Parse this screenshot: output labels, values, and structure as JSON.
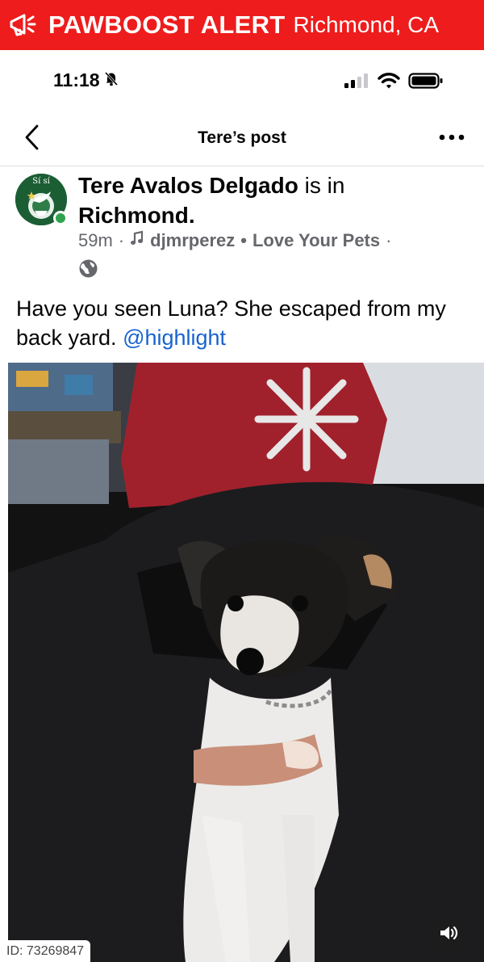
{
  "alert": {
    "title": "PAWBOOST ALERT",
    "location": "Richmond, CA",
    "brand_color": "#ee1c1c",
    "icon": "megaphone-icon"
  },
  "status_bar": {
    "time": "11:18",
    "icons": [
      "bell-slash-icon",
      "signal-icon",
      "wifi-icon",
      "battery-icon"
    ]
  },
  "header": {
    "title": "Tere’s post",
    "back_icon": "chevron-left-icon",
    "more_icon": "more-dots-icon"
  },
  "post": {
    "author": "Tere Avalos Delgado",
    "check_in_prefix": " is in",
    "place": "Richmond",
    "place_suffix": ".",
    "avatar_text": "Sí sí",
    "time_ago": "59m",
    "music_user": "djmrperez",
    "song": "Love Your Pets",
    "separator": "·",
    "bullet": "•",
    "privacy_icon": "globe-icon",
    "text": "Have you seen Luna?  She escaped from my back yard. ",
    "mention": "@highlight",
    "mention_color": "#1763cf"
  },
  "media": {
    "sound_icon": "speaker-icon",
    "id_label": "ID: 73269847"
  }
}
